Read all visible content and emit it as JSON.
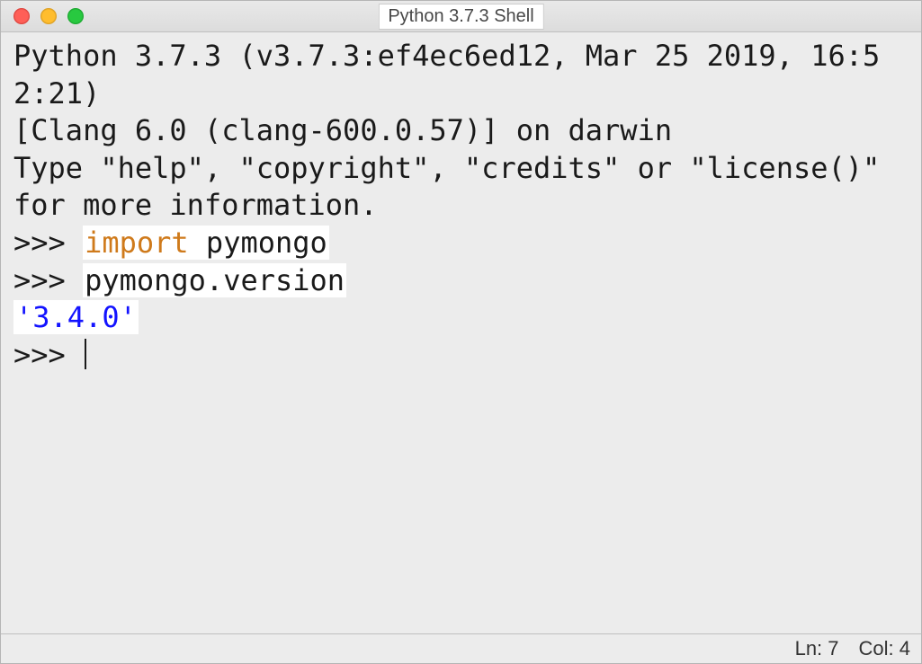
{
  "window": {
    "title": "Python 3.7.3 Shell"
  },
  "shell": {
    "banner_line1": "Python 3.7.3 (v3.7.3:ef4ec6ed12, Mar 25 2019, 16:52:21) ",
    "banner_line2": "[Clang 6.0 (clang-600.0.57)] on darwin",
    "banner_line3": "Type \"help\", \"copyright\", \"credits\" or \"license()\" for more information.",
    "prompt": ">>> ",
    "line1_keyword": "import",
    "line1_rest": " pymongo",
    "line2_code": "pymongo.version",
    "output": "'3.4.0'"
  },
  "status": {
    "line_label": "Ln: 7",
    "col_label": "Col: 4"
  }
}
